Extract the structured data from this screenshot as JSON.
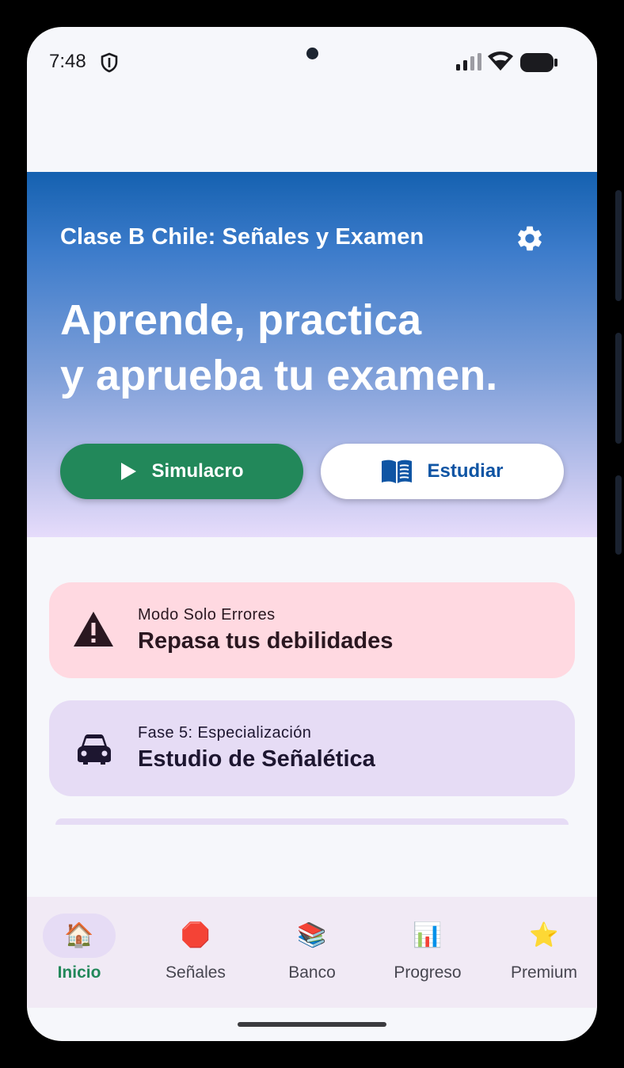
{
  "status_bar": {
    "time": "7:48"
  },
  "header": {
    "app_title": "Clase B Chile: Señales y Examen",
    "headline_line1": "Aprende, practica",
    "headline_line2": "y aprueba tu examen."
  },
  "actions": {
    "simulacro_label": "Simulacro",
    "estudiar_label": "Estudiar"
  },
  "cards": [
    {
      "subtitle": "Modo Solo Errores",
      "title": "Repasa tus debilidades",
      "icon": "warning-icon"
    },
    {
      "subtitle": "Fase 5: Especialización",
      "title": "Estudio de Señalética",
      "icon": "car-icon"
    }
  ],
  "bottom_nav": {
    "items": [
      {
        "label": "Inicio",
        "icon": "🏠",
        "active": true
      },
      {
        "label": "Señales",
        "icon": "🛑",
        "active": false
      },
      {
        "label": "Banco",
        "icon": "📚",
        "active": false
      },
      {
        "label": "Progreso",
        "icon": "📊",
        "active": false
      },
      {
        "label": "Premium",
        "icon": "⭐",
        "active": false
      }
    ]
  },
  "colors": {
    "primary_blue": "#1561b0",
    "action_green": "#22885a",
    "error_card": "#ffd9e1",
    "phase_card": "#e6dcf5",
    "nav_background": "#f1eaf5"
  }
}
